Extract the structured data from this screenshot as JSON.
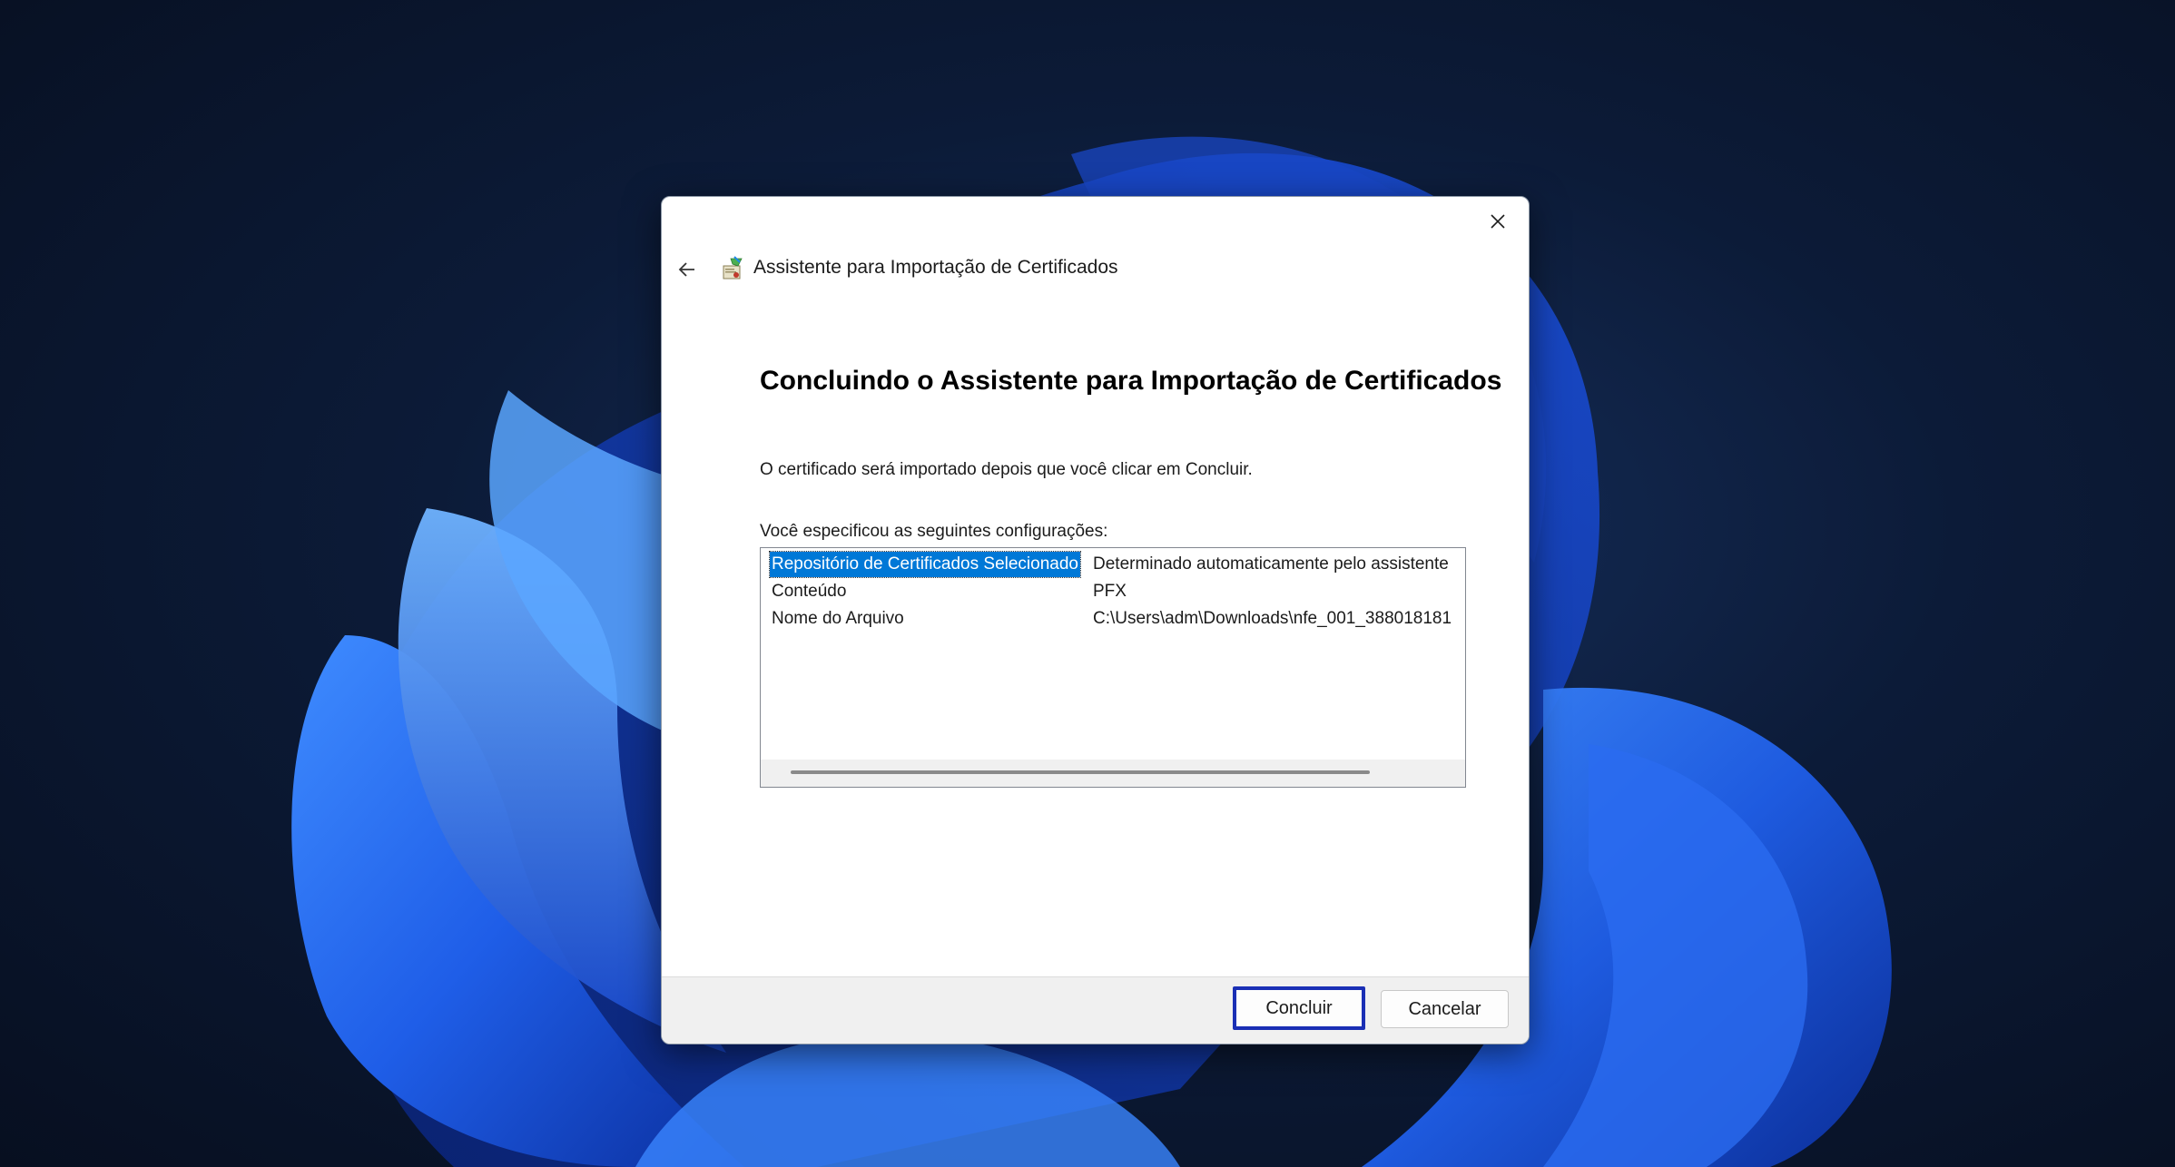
{
  "wizard": {
    "title": "Assistente para Importação de Certificados",
    "heading": "Concluindo o Assistente para Importação de Certificados",
    "intro": "O certificado será importado depois que você clicar em Concluir.",
    "settings_label": "Você especificou as seguintes configurações:",
    "settings": [
      {
        "key": "Repositório de Certificados Selecionado",
        "value": "Determinado automaticamente pelo assistente"
      },
      {
        "key": "Conteúdo",
        "value": "PFX"
      },
      {
        "key": "Nome do Arquivo",
        "value": "C:\\Users\\adm\\Downloads\\nfe_001_388018181"
      }
    ],
    "selected_row": 0
  },
  "buttons": {
    "finish": "Concluir",
    "cancel": "Cancelar"
  },
  "icons": {
    "close": "close-icon",
    "back": "back-arrow-icon",
    "wizard": "certificate-wizard-icon"
  },
  "colors": {
    "selection": "#0078d7",
    "focus_border": "#1a2fb5"
  }
}
